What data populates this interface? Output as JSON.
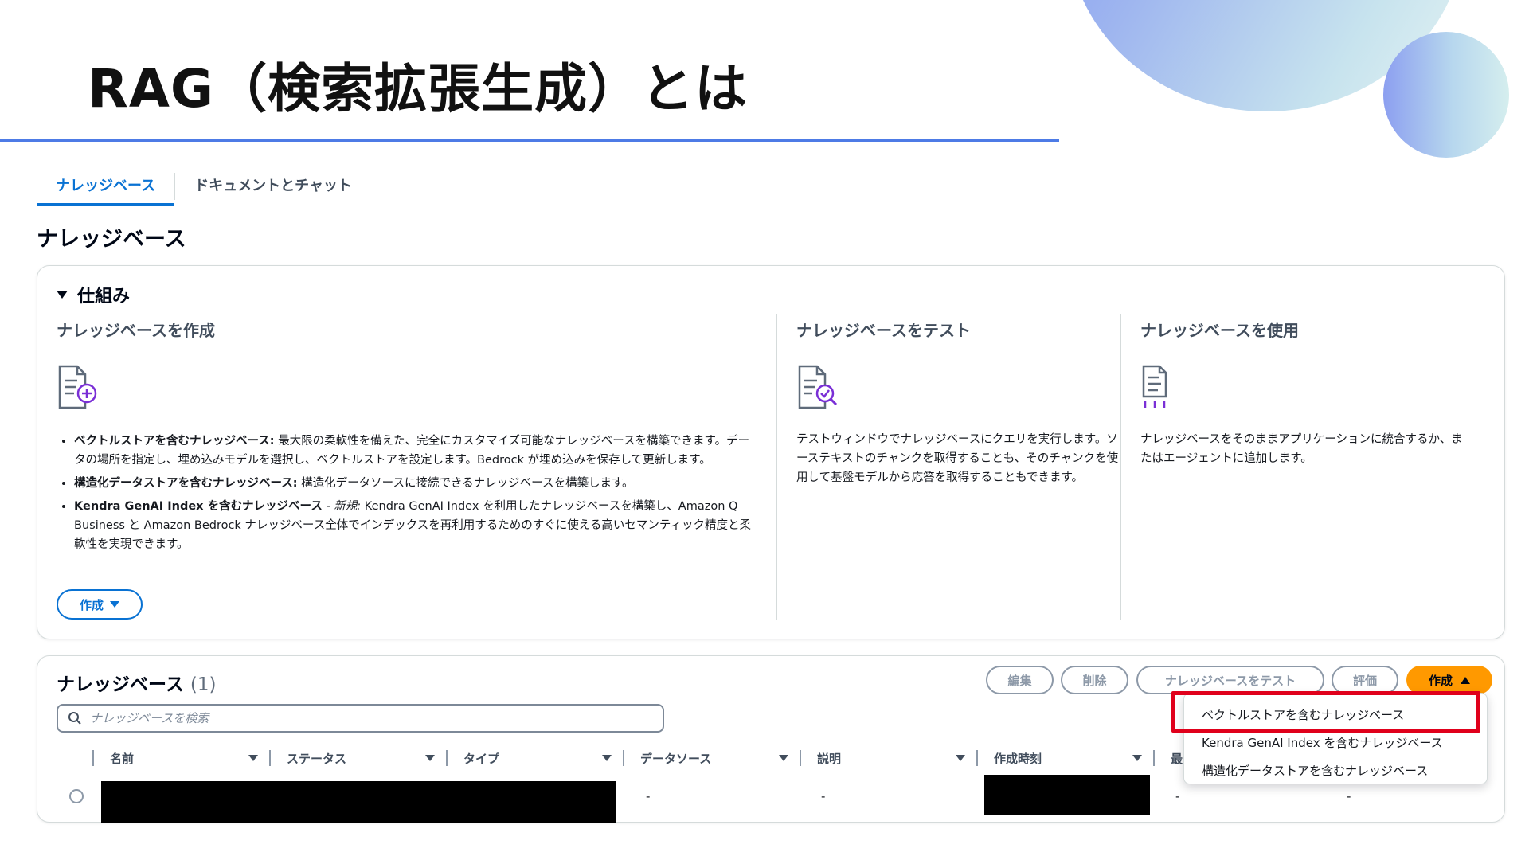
{
  "slide": {
    "title": "RAG（検索拡張生成）とは"
  },
  "tabs": [
    {
      "label": "ナレッジベース",
      "active": true
    },
    {
      "label": "ドキュメントとチャット",
      "active": false
    }
  ],
  "page_heading": "ナレッジベース",
  "how_it_works": {
    "toggle_label": "仕組み",
    "columns": [
      {
        "title": "ナレッジベースを作成",
        "icon": "document-plus-icon",
        "bullets": [
          {
            "bold": "ベクトルストアを含むナレッジベース:",
            "text": " 最大限の柔軟性を備えた、完全にカスタマイズ可能なナレッジベースを構築できます。データの場所を指定し、埋め込みモデルを選択し、ベクトルストアを設定します。Bedrock が埋め込みを保存して更新します。"
          },
          {
            "bold": "構造化データストアを含むナレッジベース:",
            "text": " 構造化データソースに接続できるナレッジベースを構築します。"
          },
          {
            "bold": "Kendra GenAI Index を含むナレッジベース",
            "dash": " - ",
            "italic": "新規:",
            "text": " Kendra GenAI Index を利用したナレッジベースを構築し、Amazon Q Business と Amazon Bedrock ナレッジベース全体でインデックスを再利用するためのすぐに使える高いセマンティック精度と柔軟性を実現できます。"
          }
        ],
        "button": "作成"
      },
      {
        "title": "ナレッジベースをテスト",
        "icon": "document-search-icon",
        "text": "テストウィンドウでナレッジベースにクエリを実行します。ソーステキストのチャンクを取得することも、そのチャンクを使用して基盤モデルから応答を取得することもできます。"
      },
      {
        "title": "ナレッジベースを使用",
        "icon": "document-connect-icon",
        "text": "ナレッジベースをそのままアプリケーションに統合するか、またはエージェントに追加します。"
      }
    ]
  },
  "list": {
    "title": "ナレッジベース",
    "count": "(1)",
    "buttons": {
      "edit": "編集",
      "delete": "削除",
      "test": "ナレッジベースをテスト",
      "evaluate": "評価",
      "create": "作成"
    },
    "search_placeholder": "ナレッジベースを検索",
    "columns": [
      "名前",
      "ステータス",
      "タイプ",
      "データソース",
      "説明",
      "作成時刻",
      "最"
    ],
    "row": {
      "data_source": "-",
      "description": "-",
      "col7": "-",
      "col8": "-"
    }
  },
  "create_menu": {
    "items": [
      "ベクトルストアを含むナレッジベース",
      "Kendra GenAI Index を含むナレッジベース",
      "構造化データストアを含むナレッジベース"
    ],
    "highlighted_index": 0,
    "highlight_color": "#e0001b"
  },
  "colors": {
    "accent_blue": "#0972d3",
    "create_orange": "#ff9900",
    "title_rule": "#4d7be6"
  }
}
